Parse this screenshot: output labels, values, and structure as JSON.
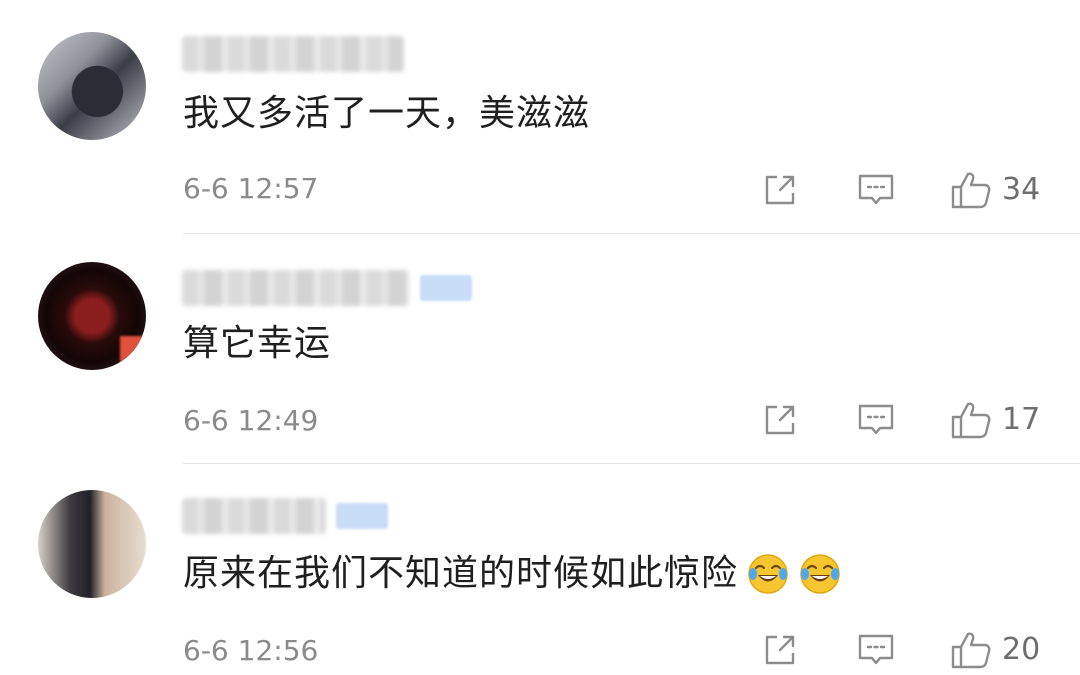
{
  "comments": [
    {
      "text": "我又多活了一天，美滋滋",
      "time": "6-6 12:57",
      "likes": "34",
      "has_badge": false,
      "emoji_count": 0
    },
    {
      "text": "算它幸运",
      "time": "6-6 12:49",
      "likes": "17",
      "has_badge": true,
      "emoji_count": 0
    },
    {
      "text": "原来在我们不知道的时候如此惊险",
      "time": "6-6 12:56",
      "likes": "20",
      "has_badge": true,
      "emoji_count": 2
    }
  ],
  "icons": {
    "share": "share-icon",
    "reply": "comment-icon",
    "like": "thumbs-up-icon",
    "emoji": "laughing-crying-emoji"
  },
  "colors": {
    "text": "#1f1f1f",
    "meta": "#8a8a8a",
    "icon": "#8c8c8c",
    "badge": "#c9dcf6",
    "divider": "#e6e6e6"
  }
}
